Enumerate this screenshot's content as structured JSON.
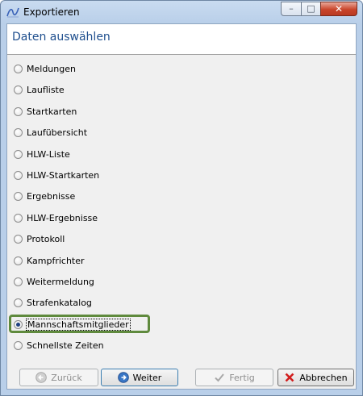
{
  "window": {
    "title": "Exportieren",
    "controls": {
      "minimize": "–",
      "maximize": "□",
      "close": "✕"
    }
  },
  "header": {
    "title": "Daten auswählen"
  },
  "options": [
    {
      "label": "Meldungen",
      "selected": false
    },
    {
      "label": "Laufliste",
      "selected": false
    },
    {
      "label": "Startkarten",
      "selected": false
    },
    {
      "label": "Laufübersicht",
      "selected": false
    },
    {
      "label": "HLW-Liste",
      "selected": false
    },
    {
      "label": "HLW-Startkarten",
      "selected": false
    },
    {
      "label": "Ergebnisse",
      "selected": false
    },
    {
      "label": "HLW-Ergebnisse",
      "selected": false
    },
    {
      "label": "Protokoll",
      "selected": false
    },
    {
      "label": "Kampfrichter",
      "selected": false
    },
    {
      "label": "Weitermeldung",
      "selected": false
    },
    {
      "label": "Strafenkatalog",
      "selected": false
    },
    {
      "label": "Mannschaftsmitglieder",
      "selected": true
    },
    {
      "label": "Schnellste Zeiten",
      "selected": false
    }
  ],
  "buttons": {
    "back": {
      "label": "Zurück",
      "icon": "arrow-left-icon",
      "enabled": false
    },
    "next": {
      "label": "Weiter",
      "icon": "arrow-right-icon",
      "enabled": true
    },
    "finish": {
      "label": "Fertig",
      "icon": "checkmark-icon",
      "enabled": false
    },
    "cancel": {
      "label": "Abbrechen",
      "icon": "close-icon",
      "enabled": true
    }
  },
  "colors": {
    "highlight": "#5f8a3d",
    "header_text": "#1f4f8e"
  }
}
